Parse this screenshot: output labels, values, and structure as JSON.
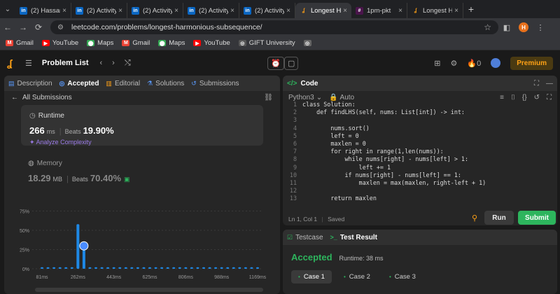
{
  "browser": {
    "tabs": [
      {
        "label": "(2) Hassan",
        "icon": "linkedin"
      },
      {
        "label": "(2) Activity",
        "icon": "linkedin"
      },
      {
        "label": "(2) Activity",
        "icon": "linkedin"
      },
      {
        "label": "(2) Activity",
        "icon": "linkedin"
      },
      {
        "label": "(2) Activity",
        "icon": "linkedin"
      },
      {
        "label": "Longest H",
        "icon": "leetcode"
      },
      {
        "label": "1pm-pkt",
        "icon": "slack"
      },
      {
        "label": "Longest H",
        "icon": "leetcode"
      }
    ],
    "url": "leetcode.com/problems/longest-harmonious-subsequence/",
    "profile_initial": "H",
    "bookmarks": [
      "Gmail",
      "YouTube",
      "Maps",
      "Gmail",
      "Maps",
      "YouTube",
      "GIFT University"
    ]
  },
  "leetcode_nav": {
    "problem_list": "Problem List",
    "streak_count": "0",
    "premium": "Premium"
  },
  "left_panel": {
    "tabs": [
      "Description",
      "Accepted",
      "Editorial",
      "Solutions",
      "Submissions"
    ],
    "back_label": "All Submissions",
    "runtime": {
      "label": "Runtime",
      "value": "266",
      "unit": "ms",
      "beats_label": "Beats",
      "beats": "19.90%",
      "analyze": "Analyze Complexity"
    },
    "memory": {
      "label": "Memory",
      "value": "18.29",
      "unit": "MB",
      "beats_label": "Beats",
      "beats": "70.40%"
    }
  },
  "chart_data": {
    "type": "bar",
    "ylabel_ticks": [
      "0%",
      "25%",
      "50%",
      "75%"
    ],
    "x_tick_labels": [
      "81ms",
      "262ms",
      "443ms",
      "625ms",
      "806ms",
      "988ms",
      "1169ms"
    ],
    "ylim": [
      0,
      80
    ],
    "values": [
      2,
      2,
      2,
      2,
      2,
      2,
      58,
      28,
      2,
      2,
      2,
      2,
      2,
      2,
      2,
      2,
      2,
      2,
      2,
      2,
      2,
      2,
      2,
      2,
      2,
      2,
      2,
      2,
      2,
      2,
      2,
      2,
      2,
      2,
      2,
      2,
      2
    ],
    "highlight_index": 7,
    "colors": {
      "bar": "#1e88e5",
      "highlight": "#4a8cff"
    }
  },
  "code_panel": {
    "title": "Code",
    "language": "Python3",
    "mode": "Auto",
    "lines": [
      {
        "n": "1",
        "t": "class Solution:"
      },
      {
        "n": "2",
        "t": "    def findLHS(self, nums: List[int]) -> int:"
      },
      {
        "n": "3",
        "t": ""
      },
      {
        "n": "4",
        "t": "        nums.sort()"
      },
      {
        "n": "5",
        "t": "        left = 0"
      },
      {
        "n": "6",
        "t": "        maxlen = 0"
      },
      {
        "n": "7",
        "t": "        for right in range(1,len(nums)):"
      },
      {
        "n": "8",
        "t": "            while nums[right] - nums[left] > 1:"
      },
      {
        "n": "9",
        "t": "                left += 1"
      },
      {
        "n": "10",
        "t": "            if nums[right] - nums[left] == 1:"
      },
      {
        "n": "11",
        "t": "                maxlen = max(maxlen, right-left + 1)"
      },
      {
        "n": "12",
        "t": ""
      },
      {
        "n": "13",
        "t": "        return maxlen"
      }
    ],
    "status_pos": "Ln 1, Col 1",
    "status_saved": "Saved",
    "run_label": "Run",
    "submit_label": "Submit"
  },
  "result_panel": {
    "tabs": [
      "Testcase",
      "Test Result"
    ],
    "status": "Accepted",
    "runtime": "Runtime: 38 ms",
    "cases": [
      "Case 1",
      "Case 2",
      "Case 3"
    ]
  }
}
